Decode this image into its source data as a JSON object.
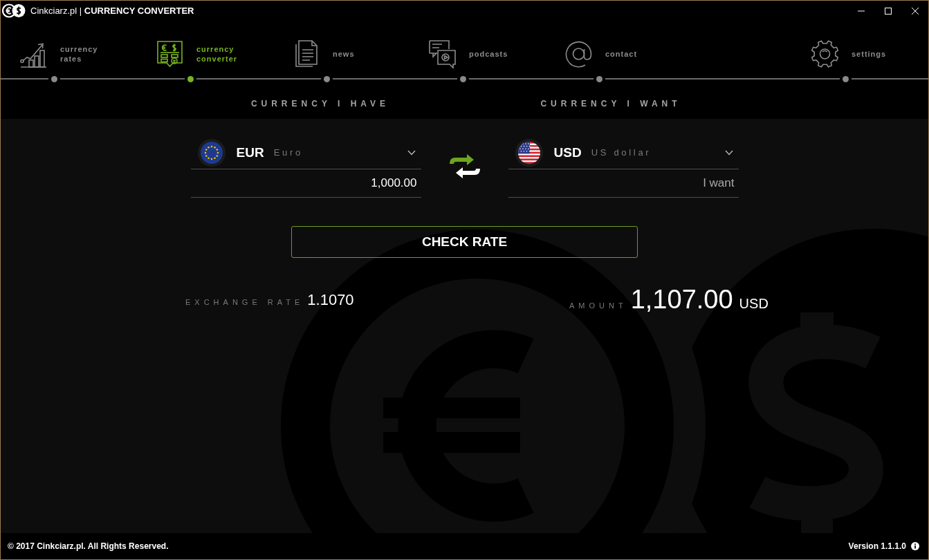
{
  "window": {
    "title": "Cinkciarz.pl | **CURRENCY CONVERTER**"
  },
  "nav": {
    "items": [
      {
        "label": "currency rates",
        "kind": "rates",
        "selected": false
      },
      {
        "label": "currency converter",
        "kind": "converter",
        "selected": true
      },
      {
        "label": "news",
        "kind": "news",
        "selected": false
      },
      {
        "label": "podcasts",
        "kind": "podcasts",
        "selected": false
      },
      {
        "label": "contact",
        "kind": "contact",
        "selected": false
      },
      {
        "label": "settings",
        "kind": "settings",
        "selected": false
      }
    ]
  },
  "converter": {
    "have": {
      "heading": "CURRENCY I HAVE",
      "code": "EUR",
      "name": "Euro",
      "kind": "eu",
      "value": "1,000.00"
    },
    "want": {
      "heading": "CURRENCY I WANT",
      "code": "USD",
      "name": "US dollar",
      "kind": "us",
      "placeholder": "I want"
    },
    "button": "CHECK RATE",
    "exchange_rate": {
      "label": "EXCHANGE RATE",
      "value": "1.1070"
    },
    "amount": {
      "label": "AMOUNT",
      "value": "1,107.00",
      "currency": "USD"
    }
  },
  "footer": {
    "copyright": "© 2017 Cinkciarz.pl. All Rights Reserved.",
    "version": "Version 1.1.1.0"
  }
}
